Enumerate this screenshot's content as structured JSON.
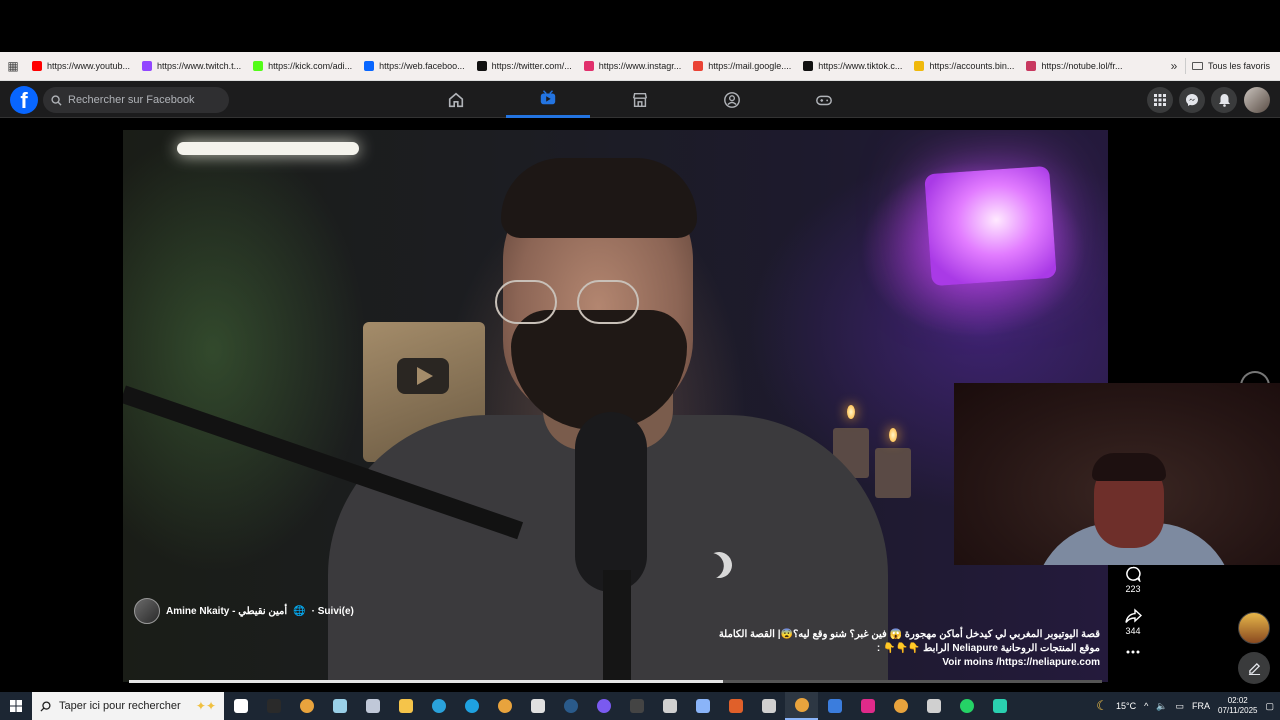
{
  "bookmarks": {
    "items": [
      {
        "label": "https://www.youtub...",
        "color": "#ff0000"
      },
      {
        "label": "https://www.twitch.t...",
        "color": "#9146ff"
      },
      {
        "label": "https://kick.com/adi...",
        "color": "#53fc18"
      },
      {
        "label": "https://web.faceboo...",
        "color": "#0866ff"
      },
      {
        "label": "https://twitter.com/...",
        "color": "#111111"
      },
      {
        "label": "https://www.instagr...",
        "color": "#e1306c"
      },
      {
        "label": "https://mail.google....",
        "color": "#ea4335"
      },
      {
        "label": "https://www.tiktok.c...",
        "color": "#111111"
      },
      {
        "label": "https://accounts.bin...",
        "color": "#f0b90b"
      },
      {
        "label": "https://notube.lol/fr...",
        "color": "#c8385f"
      }
    ],
    "all_favorites": "Tous les favoris"
  },
  "facebook": {
    "logo": "f",
    "search_placeholder": "Rechercher sur Facebook",
    "tabs": [
      "home-icon",
      "video-icon",
      "marketplace-icon",
      "groups-icon",
      "gaming-icon"
    ],
    "active_tab": 1
  },
  "video": {
    "author": "Amine Nkaity - أمين نقيطي",
    "follow_status": "· Suivi(e)",
    "caption_line1": "قصة اليوتيوبر المغربي لي كيدخل أماكن مهجورة 😱 فين غبر؟ شنو وقع ليه؟😨| القصة الكاملة",
    "caption_line2": "موقع المنتجات الروحانية Neliapure الرابط 👇👇👇 :",
    "caption_line3": "Voir moins /https://neliapure.com",
    "comments": "223",
    "shares": "344",
    "progress": 0.61
  },
  "taskbar": {
    "search_placeholder": "Taper ici pour rechercher",
    "weather": "15°C",
    "language": "FRA",
    "time": "02:02",
    "date": "07/11/2025",
    "badge": "15",
    "apps": [
      {
        "name": "task-view-icon",
        "color": "#ffffff"
      },
      {
        "name": "epic-games-icon",
        "color": "#2a2a2a"
      },
      {
        "name": "chrome-icon",
        "color": "#e8a33d"
      },
      {
        "name": "app-icon",
        "color": "#9ad0e8"
      },
      {
        "name": "app-icon",
        "color": "#c0c8d8"
      },
      {
        "name": "file-explorer-icon",
        "color": "#f5c44a"
      },
      {
        "name": "telegram-icon",
        "color": "#2aa1da"
      },
      {
        "name": "edge-icon",
        "color": "#1fa1e0"
      },
      {
        "name": "chrome-icon",
        "color": "#e8a33d"
      },
      {
        "name": "notepad-icon",
        "color": "#e0e0e0"
      },
      {
        "name": "steam-icon",
        "color": "#2a5a8a"
      },
      {
        "name": "discord-icon",
        "color": "#7a5af0"
      },
      {
        "name": "app-icon",
        "color": "#444444"
      },
      {
        "name": "app-icon",
        "color": "#d0d0d0"
      },
      {
        "name": "calculator-icon",
        "color": "#8ab4f8"
      },
      {
        "name": "app-icon",
        "color": "#e0602a"
      },
      {
        "name": "app-icon",
        "color": "#d0d0d0"
      },
      {
        "name": "chrome-icon",
        "color": "#e8a33d"
      },
      {
        "name": "app-icon",
        "color": "#3b7ddd"
      },
      {
        "name": "app-icon",
        "color": "#e02a8a"
      },
      {
        "name": "chrome-icon",
        "color": "#e8a33d"
      },
      {
        "name": "calculator-icon",
        "color": "#d0d0d0"
      },
      {
        "name": "whatsapp-icon",
        "color": "#25d366"
      },
      {
        "name": "app-icon",
        "color": "#2ad0b0"
      }
    ]
  }
}
